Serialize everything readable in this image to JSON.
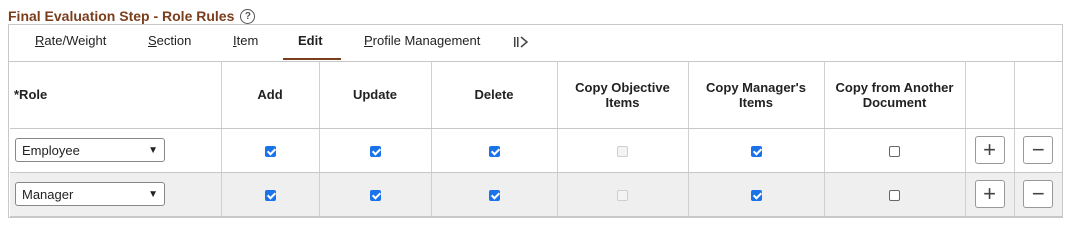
{
  "page": {
    "title": "Final Evaluation Step - Role Rules",
    "help_icon": "?"
  },
  "tabs": [
    {
      "label_acc": "R",
      "label_rest": "ate/Weight",
      "active": false
    },
    {
      "label_acc": "S",
      "label_rest": "ection",
      "active": false
    },
    {
      "label_acc": "I",
      "label_rest": "tem",
      "active": false
    },
    {
      "label_acc": "",
      "label_rest": "Edit",
      "active": true
    },
    {
      "label_acc": "P",
      "label_rest": "rofile Management",
      "active": false
    }
  ],
  "icons": {
    "more_tabs": "show-all-columns-icon",
    "add": "+",
    "remove": "−",
    "dropdown": "chevron-down-icon"
  },
  "table": {
    "headers": {
      "role": "*Role",
      "add": "Add",
      "update": "Update",
      "delete": "Delete",
      "copy_objective": "Copy Objective Items",
      "copy_manager": "Copy Manager's Items",
      "copy_another": "Copy from Another Document"
    },
    "rows": [
      {
        "role": "Employee",
        "add": true,
        "update": true,
        "delete": true,
        "copy_objective": "disabled",
        "copy_manager": true,
        "copy_another": false
      },
      {
        "role": "Manager",
        "add": true,
        "update": true,
        "delete": true,
        "copy_objective": "disabled",
        "copy_manager": true,
        "copy_another": false
      }
    ]
  },
  "colors": {
    "title": "#7a3e1d",
    "checkbox_checked": "#1a73e8",
    "alt_row": "#efefef"
  }
}
